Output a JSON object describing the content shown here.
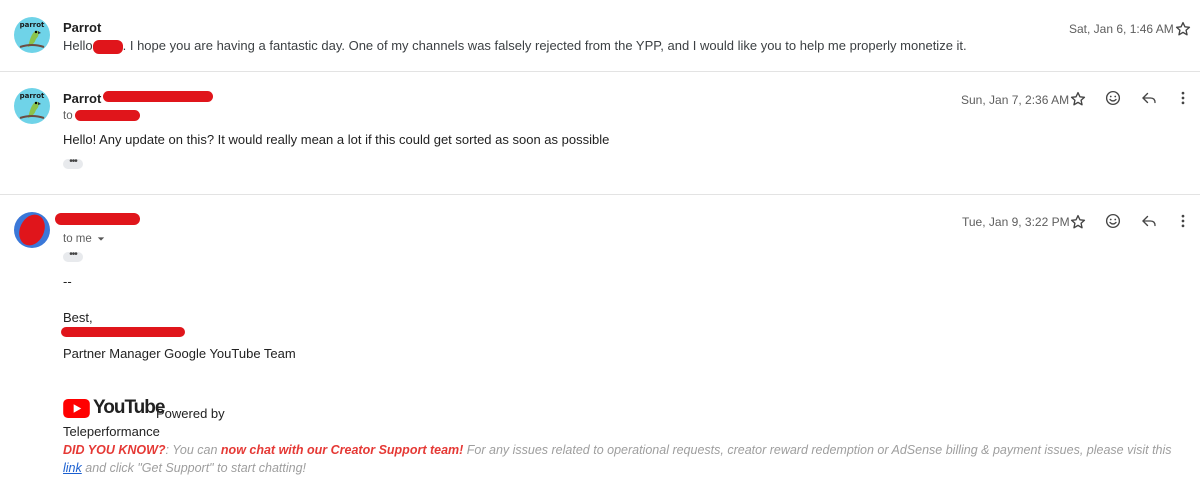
{
  "messages": [
    {
      "sender": "Parrot",
      "avatar_text": "parrot",
      "date": "Sat, Jan 6, 1:46 AM",
      "snippet_prefix": "Hello",
      "snippet_rest": ". I hope you are having a fantastic day. One of my channels was falsely rejected from the YPP, and I would like you to help me properly monetize it."
    },
    {
      "sender": "Parrot",
      "avatar_text": "parrot",
      "to_prefix": "to",
      "date": "Sun, Jan 7, 2:36 AM",
      "body": "Hello! Any update on this? It would really mean a lot if this could get sorted as soon as possible",
      "dots": "•••"
    },
    {
      "to_label": "to me",
      "date": "Tue, Jan 9, 3:22 PM",
      "dots": "•••",
      "dash": "--",
      "best": "Best,",
      "signature_title": "Partner Manager Google YouTube Team",
      "youtube_word": "YouTube",
      "powered_by": "Powered by",
      "teleperformance": "Teleperformance",
      "did_you_know": "DID YOU KNOW?",
      "dyk_colon": ": You can ",
      "chat_link_text": "now chat with our Creator Support team!",
      "dyk_middle": " For any issues related to operational requests, creator reward redemption or AdSense billing & payment issues, please visit this ",
      "link_text": "link",
      "dyk_end": " and click \"Get Support\" to start chatting!"
    }
  ],
  "colors": {
    "redaction": "#e0151b",
    "youtube_red": "#ff0000",
    "dyk_red": "#e53935",
    "link_blue": "#1a5fd0"
  },
  "icons": [
    "star-icon",
    "emoji-icon",
    "reply-icon",
    "more-vert-icon",
    "chevron-down-icon"
  ]
}
